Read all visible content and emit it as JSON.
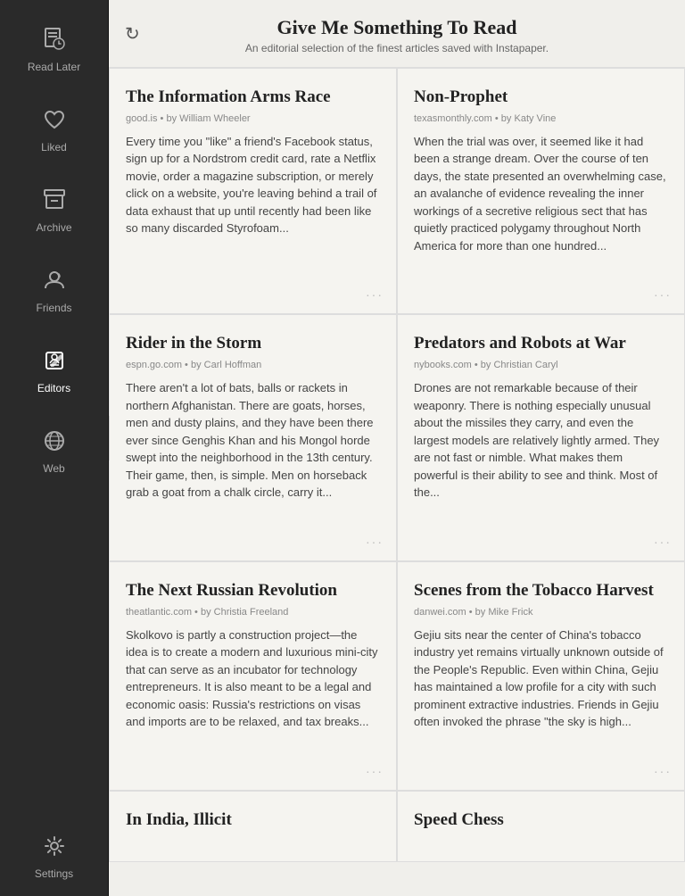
{
  "header": {
    "title": "Give Me Something To Read",
    "subtitle": "An editorial selection of the finest articles saved with Instapaper.",
    "refresh_label": "↻"
  },
  "sidebar": {
    "items": [
      {
        "id": "read-later",
        "label": "Read Later",
        "icon": "📖",
        "active": false
      },
      {
        "id": "liked",
        "label": "Liked",
        "icon": "♥",
        "active": false
      },
      {
        "id": "archive",
        "label": "Archive",
        "icon": "📂",
        "active": false
      },
      {
        "id": "friends",
        "label": "Friends",
        "icon": "💬",
        "active": false
      },
      {
        "id": "editors",
        "label": "Editors",
        "icon": "🏷",
        "active": true
      },
      {
        "id": "web",
        "label": "Web",
        "icon": "🌐",
        "active": false
      },
      {
        "id": "settings",
        "label": "Settings",
        "icon": "⚙",
        "active": false
      }
    ]
  },
  "articles": [
    {
      "id": "1",
      "title": "The Information Arms Race",
      "source": "good.is",
      "author": "William Wheeler",
      "excerpt": "Every time you \"like\" a friend's Facebook status, sign up for a Nordstrom credit card, rate a Netflix movie, order a magazine subscription, or merely click on a website, you're leaving behind a trail of data exhaust that up until recently had been like so many discarded Styrofoam..."
    },
    {
      "id": "2",
      "title": "Non-Prophet",
      "source": "texasmonthly.com",
      "author": "Katy Vine",
      "excerpt": "When the trial was over, it seemed like it had been a strange dream. Over the course of ten days, the state presented an overwhelming case, an avalanche of evidence revealing the inner workings of a secretive religious sect that has quietly practiced polygamy throughout North America for more than one hundred..."
    },
    {
      "id": "3",
      "title": "Rider in the Storm",
      "source": "espn.go.com",
      "author": "Carl Hoffman",
      "excerpt": "There aren't a lot of bats, balls or rackets in northern Afghanistan. There are goats, horses, men and dusty plains, and they have been there ever since Genghis Khan and his Mongol horde swept into the neighborhood in the 13th century. Their game, then, is simple. Men on horseback grab a goat from a chalk circle, carry it..."
    },
    {
      "id": "4",
      "title": "Predators and Robots at War",
      "source": "nybooks.com",
      "author": "Christian Caryl",
      "excerpt": "Drones are not remarkable because of their weaponry. There is nothing especially unusual about the missiles they carry, and even the largest models are relatively lightly armed. They are not fast or nimble. What makes them powerful is their ability to see and think. Most of the..."
    },
    {
      "id": "5",
      "title": "The Next Russian Revolution",
      "source": "theatlantic.com",
      "author": "Christia Freeland",
      "excerpt": "Skolkovo is partly a construction project—the idea is to create a modern and luxurious mini-city that can serve as an incubator for technology entrepreneurs. It is also meant to be a legal and economic oasis: Russia's restrictions on visas and imports are to be relaxed, and tax breaks..."
    },
    {
      "id": "6",
      "title": "Scenes from the Tobacco Harvest",
      "source": "danwei.com",
      "author": "Mike Frick",
      "excerpt": "Gejiu sits near the center of China's tobacco industry yet remains virtually unknown outside of the People's Republic. Even within China, Gejiu has maintained a low profile for a city with such prominent extractive industries. Friends in Gejiu often invoked the phrase \"the sky is high..."
    },
    {
      "id": "7",
      "title": "In India, Illicit",
      "source": "",
      "author": "",
      "excerpt": ""
    },
    {
      "id": "8",
      "title": "Speed Chess",
      "source": "",
      "author": "",
      "excerpt": ""
    }
  ]
}
